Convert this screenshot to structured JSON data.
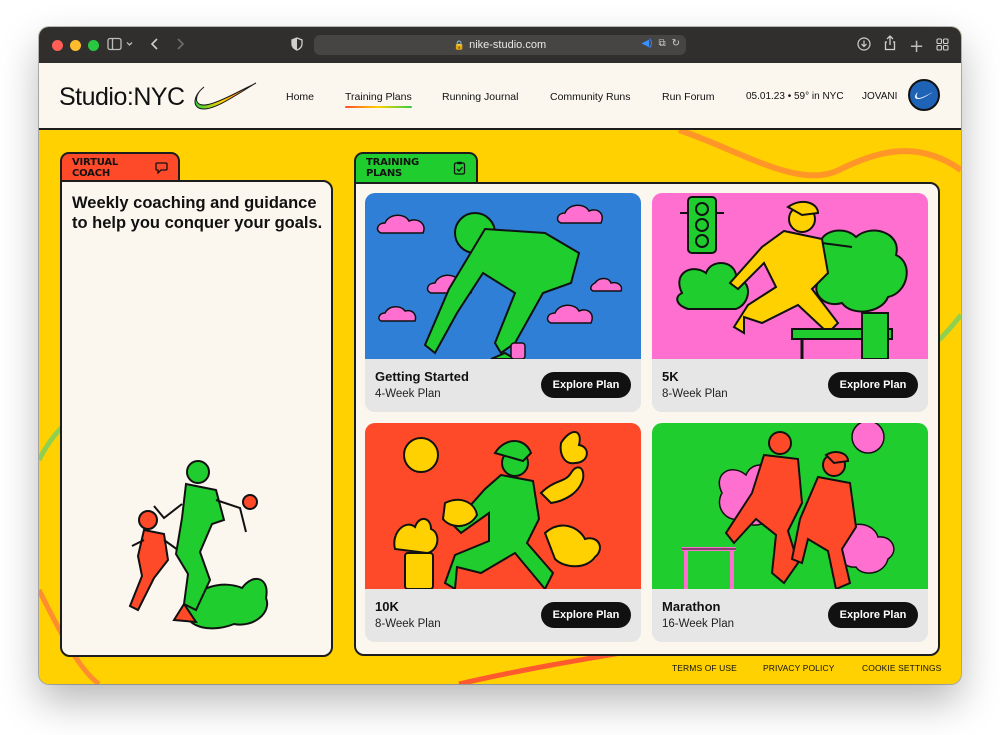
{
  "browser": {
    "url": "nike-studio.com"
  },
  "header": {
    "logo": "Studio:NYC",
    "nav": [
      "Home",
      "Training Plans",
      "Running Journal",
      "Community Runs",
      "Run Forum"
    ],
    "weather": "05.01.23 • 59° in NYC",
    "user": "JOVANI"
  },
  "coach": {
    "tab": "VIRTUAL COACH",
    "text": "Weekly coaching and guidance to help you conquer your goals."
  },
  "plans": {
    "tab": "TRAINING PLANS",
    "button_label": "Explore Plan",
    "cards": [
      {
        "title": "Getting Started",
        "subtitle": "4-Week Plan",
        "color": "#2f7fd6"
      },
      {
        "title": "5K",
        "subtitle": "8-Week Plan",
        "color": "#ff6fd0"
      },
      {
        "title": "10K",
        "subtitle": "8-Week Plan",
        "color": "#ff4a2a"
      },
      {
        "title": "Marathon",
        "subtitle": "16-Week Plan",
        "color": "#1fce2e"
      }
    ]
  },
  "footer": {
    "links": [
      "TERMS OF USE",
      "PRIVACY POLICY",
      "COOKIE SETTINGS"
    ]
  },
  "colors": {
    "background": "#ffd100",
    "panel": "#fbf7ef",
    "accent_red": "#ff4a2a",
    "accent_green": "#1fce2e"
  }
}
